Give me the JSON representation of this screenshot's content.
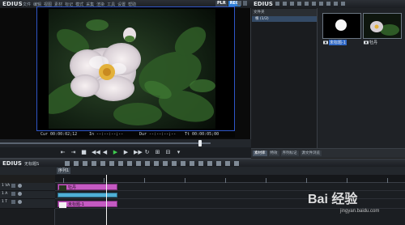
{
  "app": {
    "name": "EDIUS"
  },
  "menu": [
    "文件",
    "编辑",
    "视图",
    "素材",
    "标记",
    "模式",
    "采集",
    "渲染",
    "工具",
    "设置",
    "帮助"
  ],
  "player_toggle": {
    "plr": "PLR",
    "rec": "REC"
  },
  "viewer": {
    "timecodes": [
      {
        "label": "Cur",
        "value": "00:00:02;12"
      },
      {
        "label": "In",
        "value": "--:--:--;--"
      },
      {
        "label": "Dur",
        "value": "--:--:--;--"
      },
      {
        "label": "Tt",
        "value": "00:00:05;00"
      }
    ]
  },
  "bin": {
    "title": "EDIUS",
    "folder_header": "文件夹",
    "root": "根 (1/2)",
    "clips": [
      {
        "name": "未标题-1",
        "selected": true
      },
      {
        "name": "牡丹",
        "selected": false
      }
    ],
    "tabs": [
      "素材库",
      "特效",
      "序列标记",
      "源文件浏览"
    ]
  },
  "timeline": {
    "app": "EDIUS",
    "sequence_name": "无标题S",
    "tab": "序列1",
    "tracks": [
      {
        "id": "1 VA",
        "clip": "牡丹",
        "kind": "video"
      },
      {
        "id": "1 A",
        "clip": "",
        "kind": "audio"
      },
      {
        "id": "1 T",
        "clip": "未标题-1",
        "kind": "title"
      }
    ]
  },
  "watermark": {
    "text": "Bai 经验",
    "url": "jingyan.baidu.com"
  },
  "colors": {
    "accent": "#2f68c6",
    "clip": "#c55ac3",
    "play": "#3fcc4f"
  }
}
